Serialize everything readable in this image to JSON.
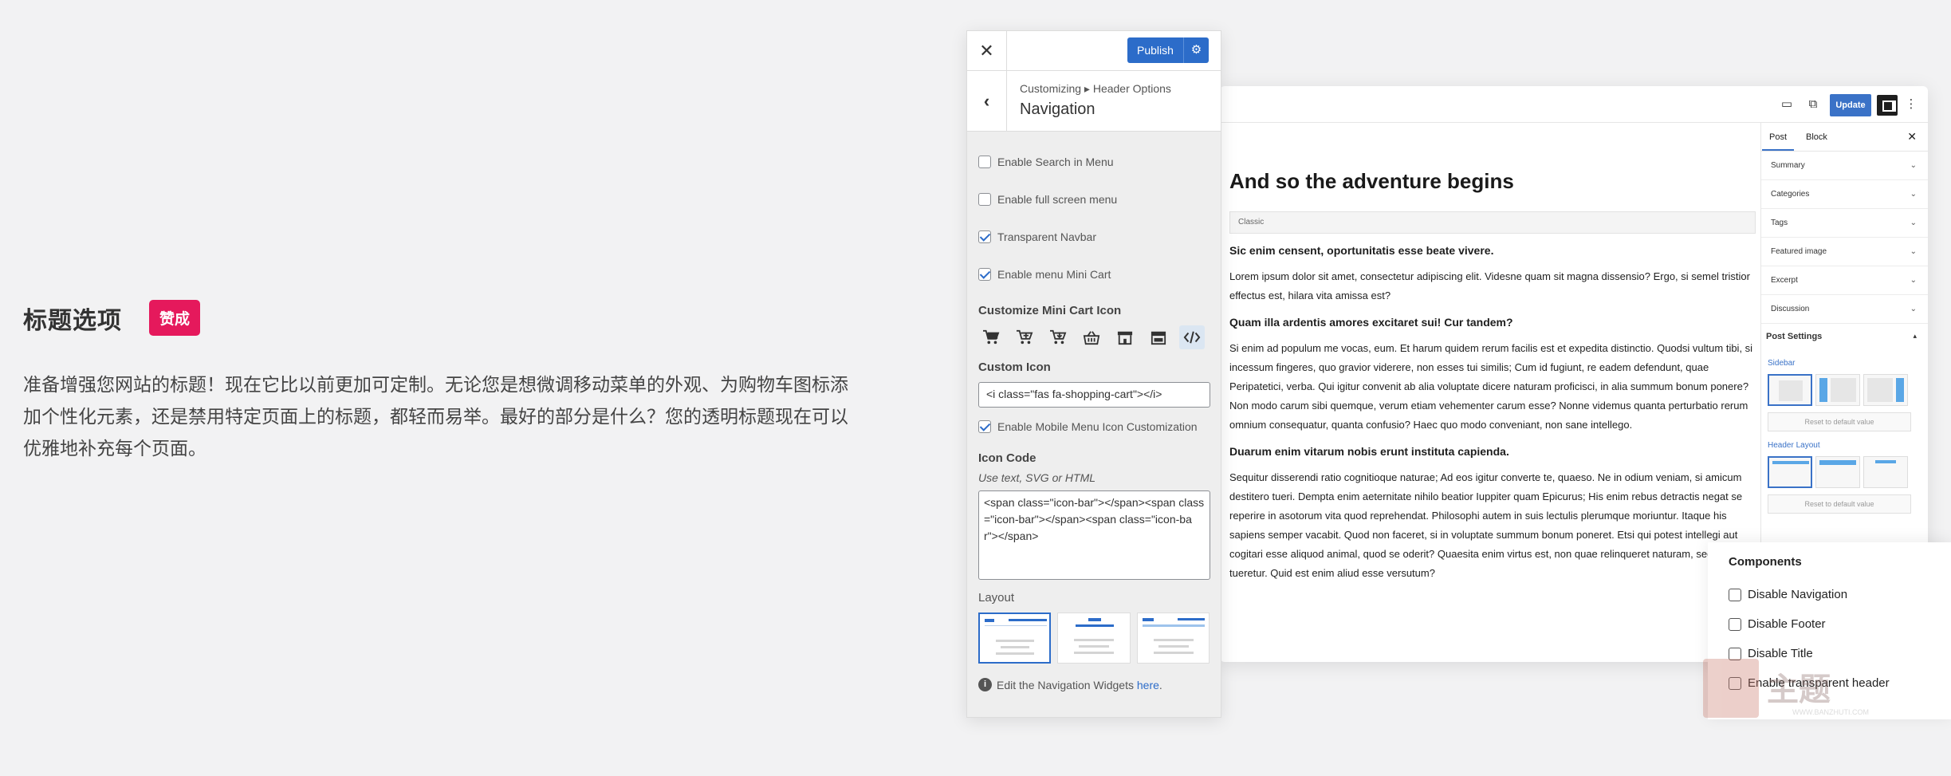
{
  "copy": {
    "title": "标题选项",
    "badge": "赞成",
    "body": "准备增强您网站的标题！现在它比以前更加可定制。无论您是想微调移动菜单的外观、为购物车图标添加个性化元素，还是禁用特定页面上的标题，都轻而易举。最好的部分是什么？您的透明标题现在可以优雅地补充每个页面。"
  },
  "customizer": {
    "publish_label": "Publish",
    "breadcrumb": "Customizing ▸ Header Options",
    "section_title": "Navigation",
    "options": [
      {
        "label": "Enable Search in Menu",
        "checked": false
      },
      {
        "label": "Enable full screen menu",
        "checked": false
      },
      {
        "label": "Transparent Navbar",
        "checked": true
      },
      {
        "label": "Enable menu Mini Cart",
        "checked": true
      }
    ],
    "mini_cart_label": "Customize Mini Cart Icon",
    "cart_icons": [
      "shopping-cart-icon",
      "cart-plus-icon",
      "cart-arrow-down-icon",
      "shopping-basket-icon",
      "store-icon",
      "store-alt-icon",
      "code-icon"
    ],
    "custom_icon_label": "Custom Icon",
    "custom_icon_value": "<i class=\"fas fa-shopping-cart\"></i>",
    "mobile_option": {
      "label": "Enable Mobile Menu Icon Customization",
      "checked": true
    },
    "icon_code_label": "Icon Code",
    "icon_code_desc": "Use text, SVG or HTML",
    "icon_code_value": "<span class=\"icon-bar\"></span><span class=\"icon-bar\"></span><span class=\"icon-bar\"></span>",
    "layout_label": "Layout",
    "footer_note": "Edit the Navigation Widgets ",
    "footer_link": "here",
    "footer_period": ".",
    "accent": "#2c6cc9"
  },
  "editor": {
    "update_label": "Update",
    "post_title": "And so the adventure begins",
    "classic_label": "Classic",
    "blocks": [
      {
        "type": "bold",
        "text": "Sic enim censent, oportunitatis esse beate vivere."
      },
      {
        "type": "text",
        "text": "Lorem ipsum dolor sit amet, consectetur adipiscing elit. Videsne quam sit magna dissensio? Ergo, si semel tristior effectus est, hilara vita amissa est?"
      },
      {
        "type": "bold",
        "text": "Quam illa ardentis amores excitaret sui! Cur tandem?"
      },
      {
        "type": "text",
        "text": "Si enim ad populum me vocas, eum. Et harum quidem rerum facilis est et expedita distinctio. Quodsi vultum tibi, si incessum fingeres, quo gravior viderere, non esses tui similis; Cum id fugiunt, re eadem defendunt, quae Peripatetici, verba. Qui igitur convenit ab alia voluptate dicere naturam proficisci, in alia summum bonum ponere? Non modo carum sibi quemque, verum etiam vehementer carum esse? Nonne videmus quanta perturbatio rerum omnium consequatur, quanta confusio? Haec quo modo conveniant, non sane intellego."
      },
      {
        "type": "bold",
        "text": "Duarum enim vitarum nobis erunt instituta capienda."
      },
      {
        "type": "text",
        "text": "Sequitur disserendi ratio cognitioque naturae; Ad eos igitur converte te, quaeso. Ne in odium veniam, si amicum destitero tueri. Dempta enim aeternitate nihilo beatior Iuppiter quam Epicurus; His enim rebus detractis negat se reperire in asotorum vita quod reprehendat. Philosophi autem in suis lectulis plerumque moriuntur. Itaque his sapiens semper vacabit. Quod non faceret, si in voluptate summum bonum poneret. Etsi qui potest intellegi aut cogitari esse aliquod animal, quod se oderit? Quaesita enim virtus est, non quae relinqueret naturam, sed quae tueretur. Quid est enim aliud esse versutum?"
      }
    ],
    "sidebar": {
      "tabs": [
        "Post",
        "Block"
      ],
      "panels": [
        "Summary",
        "Categories",
        "Tags",
        "Featured image",
        "Excerpt",
        "Discussion"
      ],
      "post_settings": "Post Settings",
      "sidebar_label": "Sidebar",
      "header_layout_label": "Header Layout",
      "reset_label": "Reset to default value"
    }
  },
  "components": {
    "title": "Components",
    "items": [
      "Disable Navigation",
      "Disable Footer",
      "Disable Title",
      "Enable transparent header"
    ]
  },
  "watermark": {
    "text": "主题",
    "url": "WWW.BANZHUTI.COM"
  }
}
